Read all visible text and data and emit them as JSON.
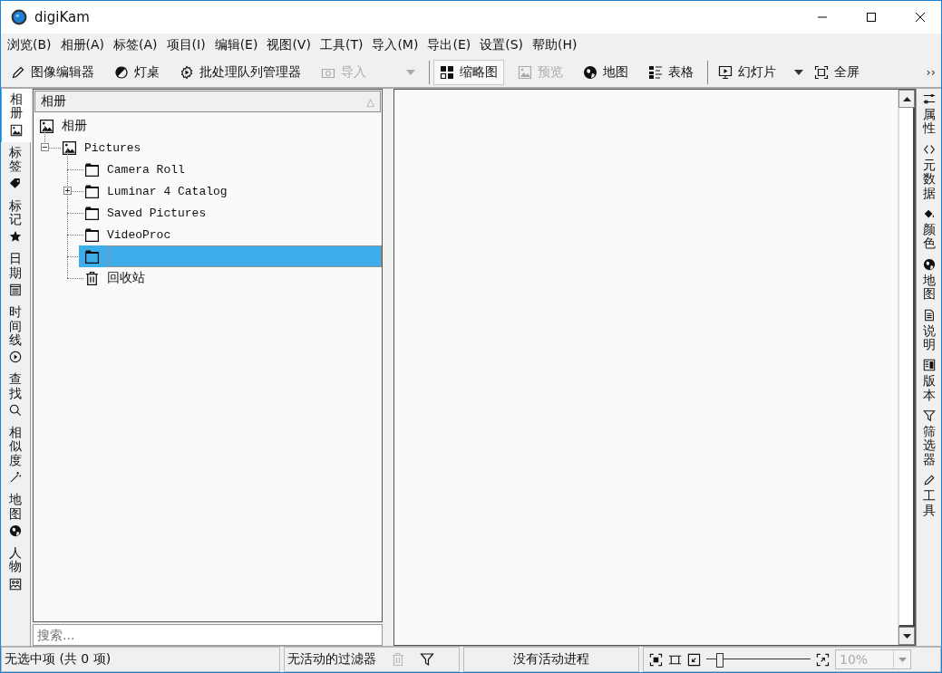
{
  "window": {
    "title": "digiKam"
  },
  "menu": [
    "浏览(B)",
    "相册(A)",
    "标签(A)",
    "项目(I)",
    "编辑(E)",
    "视图(V)",
    "工具(T)",
    "导入(M)",
    "导出(E)",
    "设置(S)",
    "帮助(H)"
  ],
  "toolbar": [
    {
      "kind": "button",
      "label": "图像编辑器",
      "disabled": false,
      "selected": false
    },
    {
      "kind": "button",
      "label": "灯桌",
      "disabled": false,
      "selected": false
    },
    {
      "kind": "button",
      "label": "批处理队列管理器",
      "disabled": false,
      "selected": false
    },
    {
      "kind": "menu-button",
      "label": "导入",
      "disabled": true,
      "selected": false
    },
    {
      "kind": "separator"
    },
    {
      "kind": "button",
      "label": "缩略图",
      "disabled": false,
      "selected": true
    },
    {
      "kind": "button",
      "label": "预览",
      "disabled": true,
      "selected": false
    },
    {
      "kind": "button",
      "label": "地图",
      "disabled": false,
      "selected": false
    },
    {
      "kind": "button",
      "label": "表格",
      "disabled": false,
      "selected": false
    },
    {
      "kind": "separator"
    },
    {
      "kind": "button",
      "label": "幻灯片",
      "disabled": false,
      "selected": false
    },
    {
      "kind": "dropdown"
    },
    {
      "kind": "button",
      "label": "全屏",
      "disabled": false,
      "selected": false
    },
    {
      "kind": "overflow",
      "label": "››"
    }
  ],
  "left_tabs": [
    {
      "label": "相册",
      "selected": true
    },
    {
      "label": "标签",
      "selected": false
    },
    {
      "label": "标记",
      "selected": false
    },
    {
      "label": "日期",
      "selected": false
    },
    {
      "label": "时间线",
      "selected": false
    },
    {
      "label": "查找",
      "selected": false
    },
    {
      "label": "相似度",
      "selected": false
    },
    {
      "label": "地图",
      "selected": false
    },
    {
      "label": "人物",
      "selected": false
    }
  ],
  "album_panel": {
    "header": "相册",
    "sort_indicator": "△",
    "tree": [
      {
        "label": "相册",
        "kind": "album",
        "selected": false,
        "children": [
          {
            "label": "Pictures",
            "kind": "album",
            "selected": false,
            "expanded": true,
            "children": [
              {
                "label": "Camera Roll",
                "kind": "folder",
                "selected": false
              },
              {
                "label": "Luminar 4 Catalog",
                "kind": "folder",
                "selected": false,
                "expanded": false
              },
              {
                "label": "Saved Pictures",
                "kind": "folder",
                "selected": false
              },
              {
                "label": "VideoProc",
                "kind": "folder",
                "selected": false
              },
              {
                "kind": "folder",
                "selected": true,
                "editing": true
              },
              {
                "label": "回收站",
                "kind": "trash",
                "selected": false
              }
            ]
          }
        ]
      }
    ],
    "search": {
      "placeholder": "搜索..."
    }
  },
  "right_tabs": [
    {
      "label": "属性",
      "selected": false
    },
    {
      "label": "元数据",
      "selected": false
    },
    {
      "label": "颜色",
      "selected": false
    },
    {
      "label": "地图",
      "selected": false
    },
    {
      "label": "说明",
      "selected": false
    },
    {
      "label": "版本",
      "selected": false
    },
    {
      "label": "筛选器",
      "selected": false
    },
    {
      "label": "工具",
      "selected": false
    }
  ],
  "status_bar": {
    "selection": "无选中项 (共 0 项)",
    "filter": "无活动的过滤器",
    "progress": "没有活动进程",
    "zoom": {
      "level": 0.12,
      "value": "10%",
      "disabled": true
    }
  }
}
